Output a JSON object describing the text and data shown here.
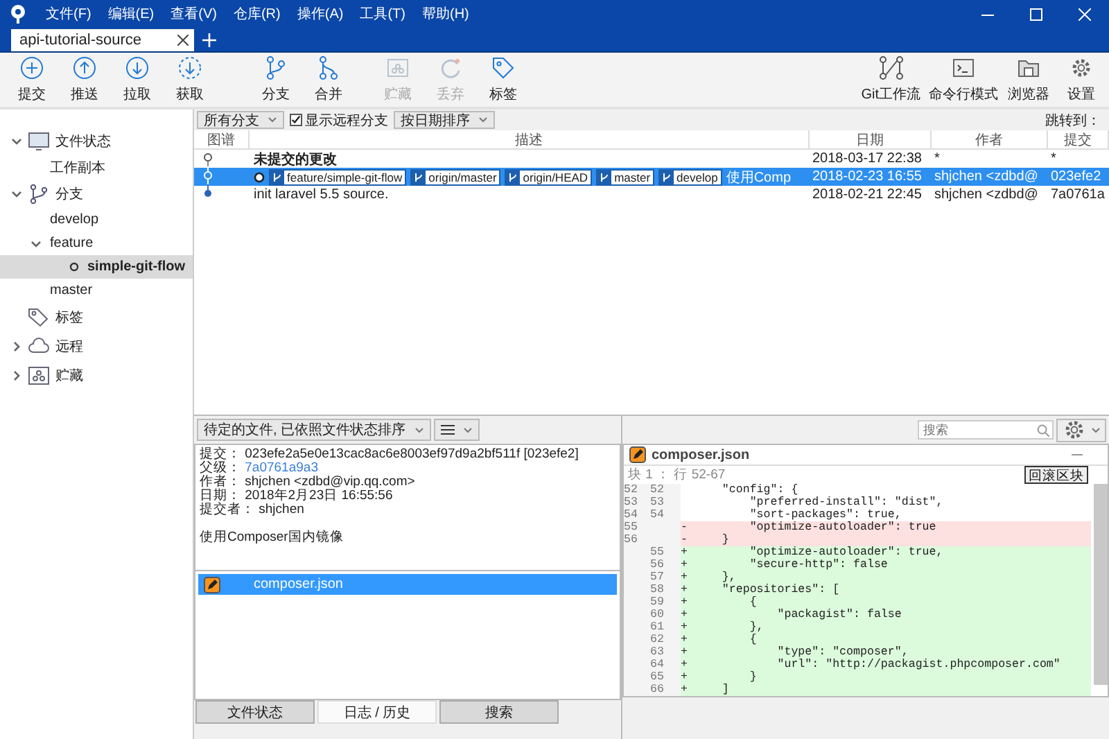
{
  "menus": [
    "文件(F)",
    "编辑(E)",
    "查看(V)",
    "仓库(R)",
    "操作(A)",
    "工具(T)",
    "帮助(H)"
  ],
  "tabs": [
    {
      "label": "api-tutorial-source",
      "selected": true
    }
  ],
  "toolbar": {
    "left": [
      {
        "label": "提交",
        "disabled": false
      },
      {
        "label": "推送",
        "disabled": false
      },
      {
        "label": "拉取",
        "disabled": false
      },
      {
        "label": "获取",
        "disabled": false
      },
      {
        "label": "分支",
        "disabled": false
      },
      {
        "label": "合并",
        "disabled": false
      },
      {
        "label": "贮藏",
        "disabled": true
      },
      {
        "label": "丢弃",
        "disabled": true
      },
      {
        "label": "标签",
        "disabled": false
      }
    ],
    "right": [
      {
        "label": "Git工作流"
      },
      {
        "label": "命令行模式"
      },
      {
        "label": "浏览器"
      },
      {
        "label": "设置"
      }
    ]
  },
  "sidebar": [
    {
      "label": "文件状态",
      "expanded": true,
      "children": [
        {
          "label": "工作副本",
          "selected": false
        }
      ]
    },
    {
      "label": "分支",
      "expanded": true,
      "children": [
        {
          "label": "develop",
          "selected": false
        },
        {
          "label": "feature",
          "selected": false,
          "expanded": true,
          "children": [
            {
              "label": "simple-git-flow",
              "selected": true,
              "current": true
            }
          ]
        },
        {
          "label": "master",
          "selected": false
        }
      ]
    },
    {
      "label": "标签"
    },
    {
      "label": "远程",
      "expanded": false
    },
    {
      "label": "贮藏",
      "expanded": false
    }
  ],
  "history": {
    "branch_filter": "所有分支",
    "show_remote": {
      "label": "显示远程分支",
      "checked": true
    },
    "sort": "按日期排序",
    "jump_label": "跳转到：",
    "columns": [
      "图谱",
      "描述",
      "日期",
      "作者",
      "提交"
    ],
    "rows": [
      {
        "description": "未提交的更改",
        "bold": true,
        "date": "2018-03-17 22:38",
        "author": "*",
        "commit": "*",
        "selected": false
      },
      {
        "refs": [
          {
            "name": "feature/simple-git-flow",
            "current": true
          },
          {
            "name": "origin/master",
            "current": false
          },
          {
            "name": "origin/HEAD",
            "current": false
          },
          {
            "name": "master",
            "current": false
          },
          {
            "name": "develop",
            "current": false
          }
        ],
        "description": "使用Comp",
        "bold": false,
        "date": "2018-02-23 16:55",
        "author": "shjchen <zdbd@",
        "commit": "023efe2",
        "selected": true
      },
      {
        "description": "init laravel 5.5 source.",
        "bold": false,
        "date": "2018-02-21 22:45",
        "author": "shjchen <zdbd@",
        "commit": "7a0761a",
        "selected": false
      }
    ]
  },
  "details": {
    "file_filter": "待定的文件, 已依照文件状态排序",
    "fields": [
      {
        "label": "提交：",
        "value": "023efe2a5e0e13cac8ac6e8003ef97d9a2bf511f [023efe2]",
        "link": false
      },
      {
        "label": "父级：",
        "value": "7a0761a9a3",
        "link": true
      },
      {
        "label": "作者：",
        "value": "shjchen <zdbd@vip.qq.com>",
        "link": false
      },
      {
        "label": "日期：",
        "value": "2018年2月23日 16:55:56",
        "link": false
      },
      {
        "label": "提交者：",
        "value": "shjchen",
        "link": false
      }
    ],
    "message": "使用Composer国内镜像",
    "files": [
      {
        "name": "composer.json",
        "selected": true
      }
    ]
  },
  "bottom_tabs": [
    {
      "label": "文件状态",
      "selected": false
    },
    {
      "label": "日志 / 历史",
      "selected": true
    },
    {
      "label": "搜索",
      "selected": false
    }
  ],
  "diff": {
    "search_placeholder": "搜索",
    "file": "composer.json",
    "hunk": "块 1 ： 行 52-67",
    "revert_button": "回滚区块",
    "lines": [
      {
        "old": "52",
        "new": "52",
        "kind": "context",
        "text": "    \"config\": {"
      },
      {
        "old": "53",
        "new": "53",
        "kind": "context",
        "text": "        \"preferred-install\": \"dist\","
      },
      {
        "old": "54",
        "new": "54",
        "kind": "context",
        "text": "        \"sort-packages\": true,"
      },
      {
        "old": "55",
        "kind": "removed",
        "marker": "-",
        "text": "        \"optimize-autoloader\": true"
      },
      {
        "old": "56",
        "kind": "removed",
        "marker": "-",
        "text": "    }"
      },
      {
        "new": "55",
        "kind": "added",
        "marker": "+",
        "text": "        \"optimize-autoloader\": true,"
      },
      {
        "new": "56",
        "kind": "added",
        "marker": "+",
        "text": "        \"secure-http\": false"
      },
      {
        "new": "57",
        "kind": "added",
        "marker": "+",
        "text": "    },"
      },
      {
        "new": "58",
        "kind": "added",
        "marker": "+",
        "text": "    \"repositories\": ["
      },
      {
        "new": "59",
        "kind": "added",
        "marker": "+",
        "text": "        {"
      },
      {
        "new": "60",
        "kind": "added",
        "marker": "+",
        "text": "            \"packagist\": false"
      },
      {
        "new": "61",
        "kind": "added",
        "marker": "+",
        "text": "        },"
      },
      {
        "new": "62",
        "kind": "added",
        "marker": "+",
        "text": "        {"
      },
      {
        "new": "63",
        "kind": "added",
        "marker": "+",
        "text": "            \"type\": \"composer\","
      },
      {
        "new": "64",
        "kind": "added",
        "marker": "+",
        "text": "            \"url\": \"http://packagist.phpcomposer.com\""
      },
      {
        "new": "65",
        "kind": "added",
        "marker": "+",
        "text": "        }"
      },
      {
        "new": "66",
        "kind": "added",
        "marker": "+",
        "text": "    ]"
      }
    ]
  }
}
